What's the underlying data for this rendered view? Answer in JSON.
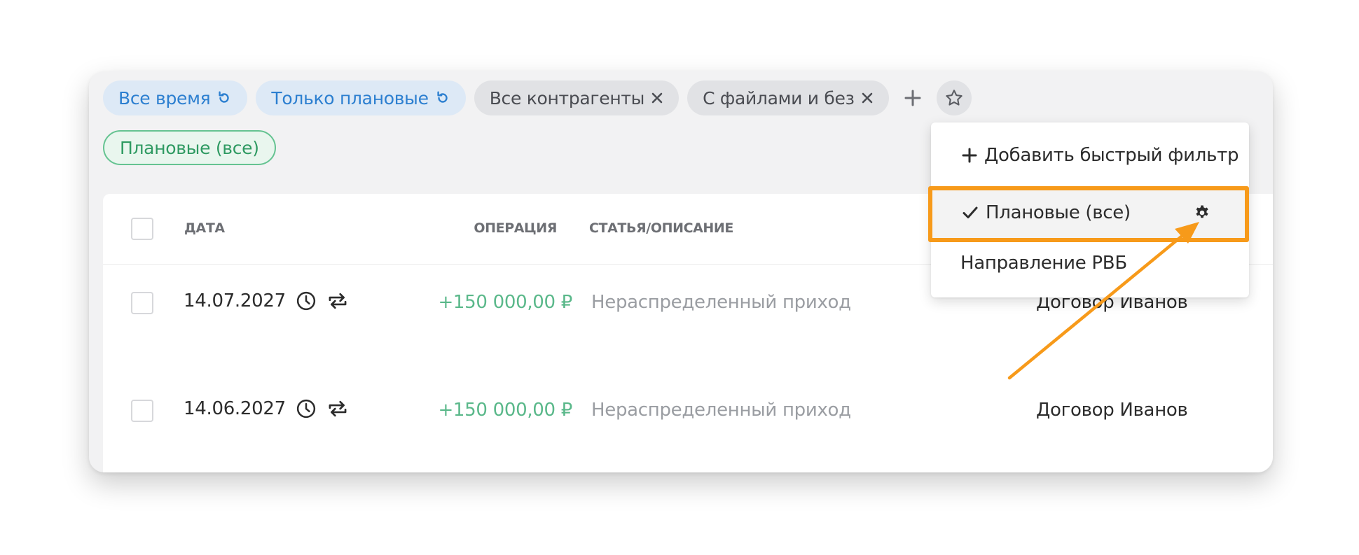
{
  "filters": {
    "period": {
      "label": "Все время",
      "icon": "reset-icon"
    },
    "plan_type": {
      "label": "Только плановые",
      "icon": "reset-icon"
    },
    "contractors": {
      "label": "Все контрагенты",
      "icon": "close-icon"
    },
    "files": {
      "label": "С файлами и без",
      "icon": "close-icon"
    },
    "add_icon": "plus-icon",
    "favorites_icon": "star-icon",
    "saved_filter": {
      "label": "Плановые (все)"
    }
  },
  "table": {
    "headers": {
      "date": "ДАТА",
      "operation": "ОПЕРАЦИЯ",
      "description": "СТАТЬЯ/ОПИСАНИЕ"
    },
    "rows": [
      {
        "date": "14.07.2027",
        "amount": "+150 000,00 ₽",
        "description": "Нераспределенный приход",
        "contract": "Договор Иванов"
      },
      {
        "date": "14.06.2027",
        "amount": "+150 000,00 ₽",
        "description": "Нераспределенный приход",
        "contract": "Договор Иванов"
      }
    ]
  },
  "dropdown": {
    "add_label": "Добавить быстрый фильтр",
    "items": [
      {
        "label": "Плановые (все)",
        "selected": true
      },
      {
        "label": "Направление РВБ",
        "selected": false
      }
    ]
  },
  "colors": {
    "accent_blue": "#2c7fd0",
    "income_green": "#5ab88a",
    "highlight_orange": "#f79a1a"
  }
}
